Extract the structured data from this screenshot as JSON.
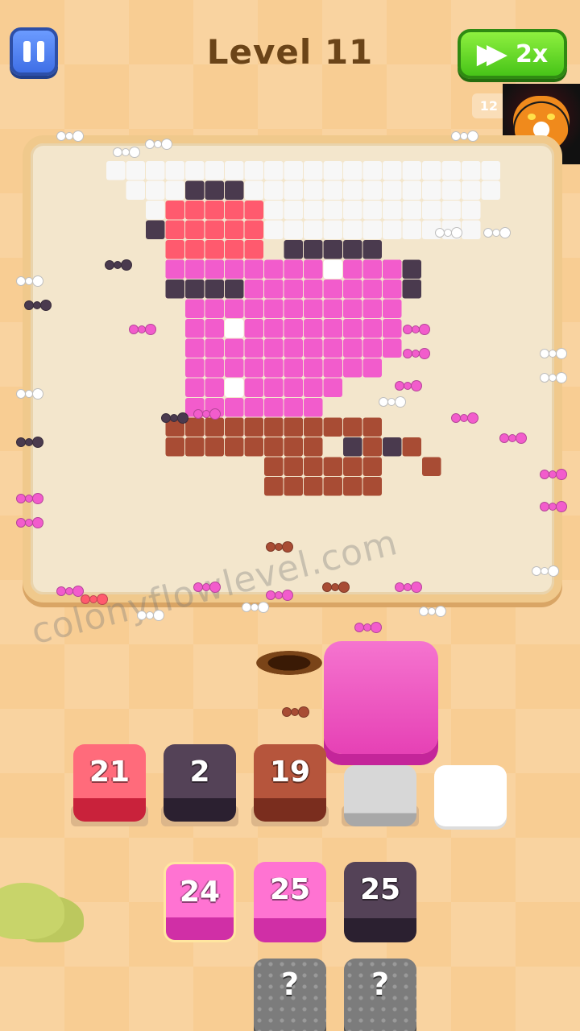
{
  "header": {
    "level_label": "Level 11",
    "speed_label": "2x",
    "corner_counter": "12"
  },
  "icons": {
    "pause": "pause-icon",
    "fast_forward": "fast-forward-icon",
    "channel_logo": "tiger-logo"
  },
  "colors": {
    "red": "#ff5a6e",
    "dark": "#4a3a4e",
    "brown": "#a84c34",
    "pink": "#f25ccc",
    "white": "#ffffff"
  },
  "top_slots": [
    {
      "value": "21",
      "color": "red"
    },
    {
      "value": "2",
      "color": "dark"
    },
    {
      "value": "19",
      "color": "brown"
    },
    {
      "value": "",
      "color": "empty-grey"
    },
    {
      "value": "",
      "color": "empty-white"
    }
  ],
  "bottom_slots": [
    {
      "value": "24",
      "color": "pink"
    },
    {
      "value": "25",
      "color": "pink"
    },
    {
      "value": "25",
      "color": "dark"
    }
  ],
  "mystery_slots": [
    {
      "value": "?"
    },
    {
      "value": "?"
    }
  ],
  "watermark": "colonyflowlevel.com"
}
